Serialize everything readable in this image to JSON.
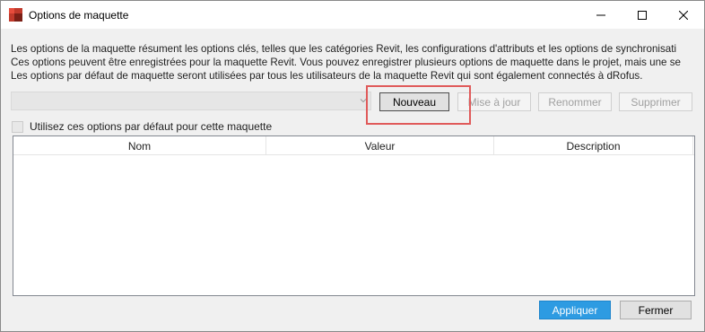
{
  "window": {
    "title": "Options de maquette",
    "icon": "revit-app-icon",
    "controls": [
      "minimize-icon",
      "maximize-icon",
      "close-icon"
    ]
  },
  "description": {
    "line1": "Les options de la maquette résument les options clés, telles que les catégories Revit, les configurations d'attributs et les options de synchronisati",
    "line2": "Ces options peuvent être enregistrées pour la maquette Revit. Vous pouvez enregistrer plusieurs options de maquette dans le projet, mais une se",
    "line3": "Les options par défaut de maquette seront utilisées par tous les utilisateurs de la maquette Revit qui sont également connectés à dRofus."
  },
  "selector": {
    "value": "",
    "enabled": false
  },
  "buttons": {
    "new": "Nouveau",
    "update": "Mise à jour",
    "rename": "Renommer",
    "delete": "Supprimer",
    "apply": "Appliquer",
    "close": "Fermer"
  },
  "default_checkbox": {
    "label": "Utilisez ces options par défaut pour cette maquette",
    "checked": false
  },
  "grid": {
    "columns": [
      "Nom",
      "Valeur",
      "Description"
    ],
    "rows": []
  },
  "colors": {
    "accent": "#2d9be2",
    "highlight": "#e05a5a"
  }
}
